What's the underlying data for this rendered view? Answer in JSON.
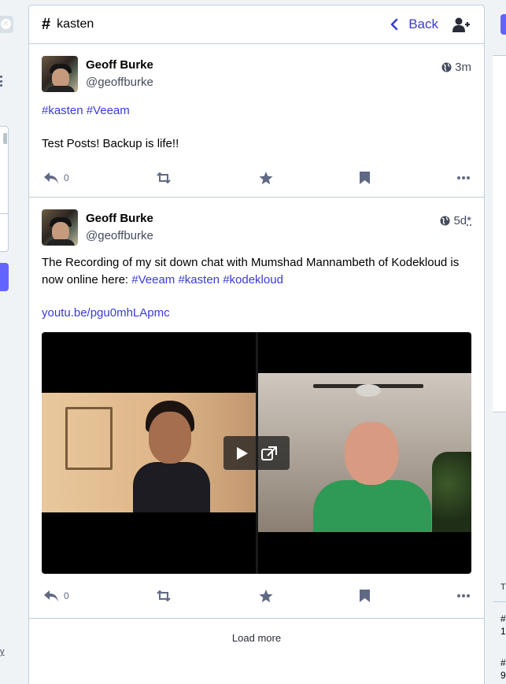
{
  "header": {
    "hash_symbol": "#",
    "title": "kasten",
    "back_label": "Back",
    "add_user_icon": "user-plus-icon"
  },
  "statuses": [
    {
      "display_name": "Geoff Burke",
      "acct": "@geoffburke",
      "visibility_icon": "globe-icon",
      "time": "3m",
      "content": {
        "tags_line": [
          "#kasten",
          "#Veeam"
        ],
        "text": "Test Posts! Backup is life!!"
      },
      "reply_count": "0"
    },
    {
      "display_name": "Geoff Burke",
      "acct": "@geoffburke",
      "visibility_icon": "globe-icon",
      "time": "5d",
      "time_suffix": "*",
      "content": {
        "text_before": "The Recording of my sit down chat with Mumshad Mannambeth of Kodekloud is now online here: ",
        "tags": [
          "#Veeam",
          "#kasten",
          "#kodekloud"
        ],
        "link": "youtu.be/pgu0mhLApmc"
      },
      "reply_count": "0"
    }
  ],
  "load_more_label": "Load more",
  "right_column": {
    "label_t": "T",
    "item1_a": "#",
    "item1_b": "1",
    "item2_a": "#",
    "item2_b": "9"
  },
  "left_column": {
    "footer_char": "y"
  },
  "colors": {
    "accent": "#3a3bd4",
    "brand": "#6364ff",
    "border": "#c0cdd9",
    "icon": "#606984",
    "background": "#eff3f5"
  }
}
